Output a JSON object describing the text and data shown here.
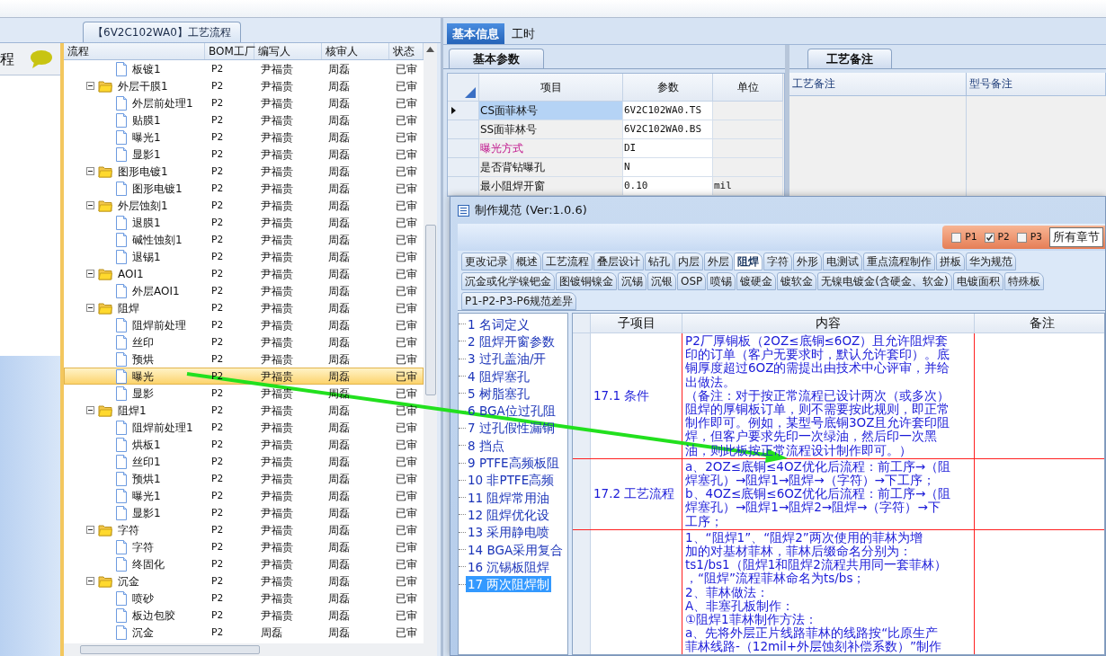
{
  "left_panel": {
    "side_label": "程",
    "tab_title": "【6V2C102WA0】工艺流程",
    "columns": [
      "流程",
      "BOM工厂",
      "编写人",
      "核审人",
      "状态"
    ],
    "tree": [
      {
        "kind": "file",
        "name": "板镀1",
        "bom": "P2",
        "writer": "尹福贵",
        "reviewer": "周磊",
        "status": "已审",
        "selected": false
      },
      {
        "kind": "folder",
        "name": "外层干膜1",
        "bom": "P2",
        "writer": "尹福贵",
        "reviewer": "周磊",
        "status": "已审",
        "selected": false,
        "expanded": true,
        "children": [
          {
            "kind": "file",
            "name": "外层前处理1",
            "bom": "P2",
            "writer": "尹福贵",
            "reviewer": "周磊",
            "status": "已审",
            "selected": false
          },
          {
            "kind": "file",
            "name": "贴膜1",
            "bom": "P2",
            "writer": "尹福贵",
            "reviewer": "周磊",
            "status": "已审",
            "selected": false
          },
          {
            "kind": "file",
            "name": "曝光1",
            "bom": "P2",
            "writer": "尹福贵",
            "reviewer": "周磊",
            "status": "已审",
            "selected": false
          },
          {
            "kind": "file",
            "name": "显影1",
            "bom": "P2",
            "writer": "尹福贵",
            "reviewer": "周磊",
            "status": "已审",
            "selected": false
          }
        ]
      },
      {
        "kind": "folder",
        "name": "图形电镀1",
        "bom": "P2",
        "writer": "尹福贵",
        "reviewer": "周磊",
        "status": "已审",
        "selected": false,
        "expanded": true,
        "children": [
          {
            "kind": "file",
            "name": "图形电镀1",
            "bom": "P2",
            "writer": "尹福贵",
            "reviewer": "周磊",
            "status": "已审",
            "selected": false
          }
        ]
      },
      {
        "kind": "folder",
        "name": "外层蚀刻1",
        "bom": "P2",
        "writer": "尹福贵",
        "reviewer": "周磊",
        "status": "已审",
        "selected": false,
        "expanded": true,
        "children": [
          {
            "kind": "file",
            "name": "退膜1",
            "bom": "P2",
            "writer": "尹福贵",
            "reviewer": "周磊",
            "status": "已审",
            "selected": false
          },
          {
            "kind": "file",
            "name": "碱性蚀刻1",
            "bom": "P2",
            "writer": "尹福贵",
            "reviewer": "周磊",
            "status": "已审",
            "selected": false
          },
          {
            "kind": "file",
            "name": "退锡1",
            "bom": "P2",
            "writer": "尹福贵",
            "reviewer": "周磊",
            "status": "已审",
            "selected": false
          }
        ]
      },
      {
        "kind": "folder",
        "name": "AOI1",
        "bom": "P2",
        "writer": "尹福贵",
        "reviewer": "周磊",
        "status": "已审",
        "selected": false,
        "expanded": true,
        "children": [
          {
            "kind": "file",
            "name": "外层AOI1",
            "bom": "P2",
            "writer": "尹福贵",
            "reviewer": "周磊",
            "status": "已审",
            "selected": false
          }
        ]
      },
      {
        "kind": "folder",
        "name": "阻焊",
        "bom": "P2",
        "writer": "尹福贵",
        "reviewer": "周磊",
        "status": "已审",
        "selected": false,
        "expanded": true,
        "children": [
          {
            "kind": "file",
            "name": "阻焊前处理",
            "bom": "P2",
            "writer": "尹福贵",
            "reviewer": "周磊",
            "status": "已审",
            "selected": false
          },
          {
            "kind": "file",
            "name": "丝印",
            "bom": "P2",
            "writer": "尹福贵",
            "reviewer": "周磊",
            "status": "已审",
            "selected": false
          },
          {
            "kind": "file",
            "name": "预烘",
            "bom": "P2",
            "writer": "尹福贵",
            "reviewer": "周磊",
            "status": "已审",
            "selected": false
          },
          {
            "kind": "file",
            "name": "曝光",
            "bom": "P2",
            "writer": "尹福贵",
            "reviewer": "周磊",
            "status": "已审",
            "selected": true
          },
          {
            "kind": "file",
            "name": "显影",
            "bom": "P2",
            "writer": "尹福贵",
            "reviewer": "周磊",
            "status": "已审",
            "selected": false
          }
        ]
      },
      {
        "kind": "folder",
        "name": "阻焊1",
        "bom": "P2",
        "writer": "尹福贵",
        "reviewer": "周磊",
        "status": "已审",
        "selected": false,
        "expanded": true,
        "children": [
          {
            "kind": "file",
            "name": "阻焊前处理1",
            "bom": "P2",
            "writer": "尹福贵",
            "reviewer": "周磊",
            "status": "已审",
            "selected": false
          },
          {
            "kind": "file",
            "name": "烘板1",
            "bom": "P2",
            "writer": "尹福贵",
            "reviewer": "周磊",
            "status": "已审",
            "selected": false
          },
          {
            "kind": "file",
            "name": "丝印1",
            "bom": "P2",
            "writer": "尹福贵",
            "reviewer": "周磊",
            "status": "已审",
            "selected": false
          },
          {
            "kind": "file",
            "name": "预烘1",
            "bom": "P2",
            "writer": "尹福贵",
            "reviewer": "周磊",
            "status": "已审",
            "selected": false
          },
          {
            "kind": "file",
            "name": "曝光1",
            "bom": "P2",
            "writer": "尹福贵",
            "reviewer": "周磊",
            "status": "已审",
            "selected": false
          },
          {
            "kind": "file",
            "name": "显影1",
            "bom": "P2",
            "writer": "尹福贵",
            "reviewer": "周磊",
            "status": "已审",
            "selected": false
          }
        ]
      },
      {
        "kind": "folder",
        "name": "字符",
        "bom": "P2",
        "writer": "尹福贵",
        "reviewer": "周磊",
        "status": "已审",
        "selected": false,
        "expanded": true,
        "children": [
          {
            "kind": "file",
            "name": "字符",
            "bom": "P2",
            "writer": "尹福贵",
            "reviewer": "周磊",
            "status": "已审",
            "selected": false
          },
          {
            "kind": "file",
            "name": "终固化",
            "bom": "P2",
            "writer": "尹福贵",
            "reviewer": "周磊",
            "status": "已审",
            "selected": false
          }
        ]
      },
      {
        "kind": "folder",
        "name": "沉金",
        "bom": "P2",
        "writer": "尹福贵",
        "reviewer": "周磊",
        "status": "已审",
        "selected": false,
        "expanded": true,
        "children": [
          {
            "kind": "file",
            "name": "喷砂",
            "bom": "P2",
            "writer": "尹福贵",
            "reviewer": "周磊",
            "status": "已审",
            "selected": false
          },
          {
            "kind": "file",
            "name": "板边包胶",
            "bom": "P2",
            "writer": "尹福贵",
            "reviewer": "周磊",
            "status": "已审",
            "selected": false
          },
          {
            "kind": "file",
            "name": "沉金",
            "bom": "P2",
            "writer": "周磊",
            "reviewer": "周磊",
            "status": "已审",
            "selected": false
          }
        ]
      }
    ]
  },
  "right_panel": {
    "tabs": [
      {
        "label": "基本信息",
        "selected": true
      },
      {
        "label": "工时",
        "selected": false
      }
    ],
    "params": {
      "tab": "基本参数",
      "columns": [
        "项目",
        "参数",
        "单位"
      ],
      "rows": [
        {
          "item": "CS面菲林号",
          "value": "6V2C102WA0.TS",
          "selected": true,
          "emphasized": false
        },
        {
          "item": "SS面菲林号",
          "value": "6V2C102WA0.BS",
          "selected": false,
          "emphasized": false
        },
        {
          "item": "曝光方式",
          "value": "DI",
          "selected": false,
          "emphasized": true
        },
        {
          "item": "是否背钻曝孔",
          "value": "N",
          "selected": false,
          "emphasized": false
        },
        {
          "item": "最小阻焊开窗",
          "value": "0.10",
          "unit": "mil",
          "selected": false,
          "emphasized": false
        }
      ]
    },
    "notes": {
      "tab": "工艺备注",
      "columns": [
        "工艺备注",
        "型号备注"
      ]
    }
  },
  "dialog": {
    "title": "制作规范 (Ver:1.0.6)",
    "filters": [
      {
        "label": "P1",
        "checked": false
      },
      {
        "label": "P2",
        "checked": true
      },
      {
        "label": "P3",
        "checked": false
      }
    ],
    "chapter_select": "所有章节",
    "tab_rows": [
      [
        {
          "label": "更改记录",
          "selected": false
        },
        {
          "label": "概述",
          "selected": false
        },
        {
          "label": "工艺流程",
          "selected": false
        },
        {
          "label": "叠层设计",
          "selected": false
        },
        {
          "label": "钻孔",
          "selected": false
        },
        {
          "label": "内层",
          "selected": false
        },
        {
          "label": "外层",
          "selected": false
        },
        {
          "label": "阻焊",
          "selected": true
        },
        {
          "label": "字符",
          "selected": false
        },
        {
          "label": "外形",
          "selected": false
        },
        {
          "label": "电测试",
          "selected": false
        },
        {
          "label": "重点流程制作",
          "selected": false
        },
        {
          "label": "拼板",
          "selected": false
        },
        {
          "label": "华为规范",
          "selected": false
        }
      ],
      [
        {
          "label": "沉金或化学镍钯金",
          "selected": false
        },
        {
          "label": "图镀铜镍金",
          "selected": false
        },
        {
          "label": "沉锡",
          "selected": false
        },
        {
          "label": "沉银",
          "selected": false
        },
        {
          "label": "OSP",
          "selected": false
        },
        {
          "label": "喷锡",
          "selected": false
        },
        {
          "label": "镀硬金",
          "selected": false
        },
        {
          "label": "镀软金",
          "selected": false
        },
        {
          "label": "无镍电镀金(含硬金、软金)",
          "selected": false
        },
        {
          "label": "电镀面积",
          "selected": false
        },
        {
          "label": "特殊板",
          "selected": false
        }
      ],
      [
        {
          "label": "P1-P2-P3-P6规范差异",
          "selected": false
        }
      ]
    ],
    "chapters": [
      {
        "number": "1",
        "title": "名词定义",
        "selected": false
      },
      {
        "number": "2",
        "title": "阻焊开窗参数",
        "selected": false
      },
      {
        "number": "3",
        "title": "过孔盖油/开",
        "selected": false
      },
      {
        "number": "4",
        "title": "阻焊塞孔",
        "selected": false
      },
      {
        "number": "5",
        "title": "树脂塞孔",
        "selected": false
      },
      {
        "number": "6",
        "title": "BGA位过孔阻",
        "selected": false
      },
      {
        "number": "7",
        "title": "过孔假性漏铜",
        "selected": false
      },
      {
        "number": "8",
        "title": "挡点",
        "selected": false
      },
      {
        "number": "9",
        "title": "PTFE高频板阻",
        "selected": false
      },
      {
        "number": "10",
        "title": "非PTFE高频",
        "selected": false
      },
      {
        "number": "11",
        "title": "阻焊常用油",
        "selected": false
      },
      {
        "number": "12",
        "title": "阻焊优化设",
        "selected": false
      },
      {
        "number": "13",
        "title": "采用静电喷",
        "selected": false
      },
      {
        "number": "14",
        "title": "BGA采用复合",
        "selected": false
      },
      {
        "number": "16",
        "title": "沉锡板阻焊",
        "selected": false
      },
      {
        "number": "17",
        "title": "两次阻焊制",
        "selected": true
      }
    ],
    "columns": [
      "子项目",
      "内容",
      "备注"
    ],
    "rows": [
      {
        "item": "17.1 条件",
        "lines": [
          "P2厂厚铜板（2OZ≤底铜≤6OZ）且允许阻焊套",
          "印的订单（客户无要求时，默认允许套印）。底",
          "铜厚度超过6OZ的需提出由技术中心评审，并给",
          "出做法。",
          "（备注：对于按正常流程已设计两次（或多次）",
          "阻焊的厚铜板订单，则不需要按此规则，即正常",
          "制作即可。例如，某型号底铜3OZ且允许套印阻",
          "焊，但客户要求先印一次绿油，然后印一次黑",
          "油，则此板按正常流程设计制作即可。）"
        ]
      },
      {
        "item": "17.2 工艺流程",
        "lines": [
          "a、2OZ≤底铜≤4OZ优化后流程：前工序→（阻",
          "焊塞孔）→阻焊1→阻焊→（字符）→下工序；",
          "b、4OZ≤底铜≤6OZ优化后流程：前工序→（阻",
          "焊塞孔）→阻焊1→阻焊2→阻焊→（字符）→下",
          "工序；"
        ]
      },
      {
        "lines": [
          "1、“阻焊1”、“阻焊2”两次使用的菲林为增",
          "加的对基材菲林，菲林后缀命名分别为：",
          "ts1/bs1（阻焊1和阻焊2流程共用同一套菲林）",
          "，“阻焊”流程菲林命名为ts/bs；",
          "2、菲林做法：",
          "A、非塞孔板制作：",
          "①阻焊1菲林制作方法：",
          "a、先将外层正片线路菲林的线路按“比原生产",
          "菲林线路-（12mil+外层蚀刻补偿系数）”制作"
        ]
      }
    ]
  }
}
